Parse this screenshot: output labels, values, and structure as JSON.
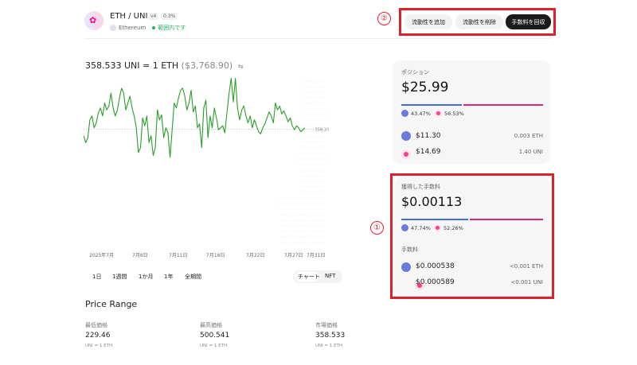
{
  "header": {
    "pair": "ETH / UNI",
    "version": "v4",
    "fee_tier": "0.3%",
    "network": "Ethereum",
    "range_status": "範囲内です"
  },
  "annotations": {
    "marker_1": "①",
    "marker_2": "②"
  },
  "actions": {
    "add_liquidity": "流動性を追加",
    "remove_liquidity": "流動性を削除",
    "collect_fees": "手数料を回収"
  },
  "price": {
    "rate": "358.533 UNI = 1 ETH",
    "usd": "($3,768.90)",
    "swap_icon": "⇆"
  },
  "chart_data": {
    "type": "line",
    "series": [
      {
        "values": [
          352,
          345,
          350,
          368,
          372,
          360,
          365,
          375,
          380,
          372,
          385,
          378,
          382,
          395,
          380,
          372,
          378,
          390,
          400,
          395,
          378,
          385,
          392,
          380,
          372,
          360,
          335,
          340,
          370,
          362,
          372,
          345,
          352,
          332,
          340,
          378,
          368,
          373,
          350,
          360,
          355,
          330,
          358,
          385,
          380,
          390,
          398,
          400,
          392,
          378,
          385,
          398,
          376,
          382,
          360,
          364,
          340,
          380,
          388,
          350,
          372,
          360,
          380,
          370,
          358,
          360,
          362,
          355,
          375,
          395,
          410,
          386,
          410,
          380,
          368,
          378,
          382,
          372,
          365,
          372,
          360,
          368,
          362,
          356,
          354,
          360,
          364,
          370,
          376,
          372,
          365,
          385,
          378,
          382,
          374,
          377,
          372,
          366,
          370,
          362,
          358,
          362,
          360,
          356,
          358,
          360
        ]
      }
    ],
    "x_ticks": [
      "2025年7月",
      "7月6日",
      "7月11日",
      "7月16日",
      "7月22日",
      "7月27日",
      "7月31日"
    ],
    "reference_label": "358.10",
    "current_value": 358.53,
    "color": "#2a9d2a",
    "time_ranges": [
      "1日",
      "1週間",
      "1か月",
      "1年",
      "全期間"
    ],
    "view_toggle": [
      "チャート",
      "NFT"
    ]
  },
  "price_range": {
    "title": "Price Range",
    "min": {
      "label": "最低価格",
      "value": "229.46",
      "unit": "UNI = 1 ETH"
    },
    "max": {
      "label": "最高価格",
      "value": "500.541",
      "unit": "UNI = 1 ETH"
    },
    "market": {
      "label": "市場価格",
      "value": "358.533",
      "unit": "UNI = 1 ETH"
    }
  },
  "position": {
    "label": "ポジション",
    "value": "$25.99",
    "eth_pct": "43.47%",
    "uni_pct": "56.53%",
    "eth_share": 0.4347,
    "eth_usd": "$11.30",
    "eth_amount": "0.003 ETH",
    "uni_usd": "$14.69",
    "uni_amount": "1.40 UNI"
  },
  "fees": {
    "label": "獲得した手数料",
    "value": "$0.00113",
    "eth_pct": "47.74%",
    "uni_pct": "52.26%",
    "eth_share": 0.4774,
    "section_label": "手数料",
    "eth_usd": "$0.000538",
    "eth_amount": "<0.001 ETH",
    "uni_usd": "$0.000589",
    "uni_amount": "<0.001 UNI"
  },
  "colors": {
    "accent_red": "#e0202a",
    "eth_blue": "#3f6fd9",
    "uni_pink": "#e0267a",
    "in_range_green": "#27ae60"
  }
}
